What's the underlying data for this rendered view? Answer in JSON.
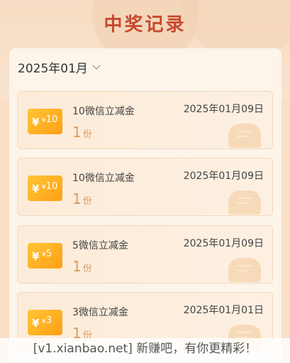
{
  "header": {
    "title": "中奖记录"
  },
  "filter": {
    "month": "2025年01月"
  },
  "records": [
    {
      "coupon_value": "10",
      "coupon_symbol": "¥",
      "title": "10微信立减金",
      "date": "2025年01月09日",
      "qty": "1",
      "unit": "份"
    },
    {
      "coupon_value": "10",
      "coupon_symbol": "¥",
      "title": "10微信立减金",
      "date": "2025年01月09日",
      "qty": "1",
      "unit": "份"
    },
    {
      "coupon_value": "5",
      "coupon_symbol": "¥",
      "title": "5微信立减金",
      "date": "2025年01月09日",
      "qty": "1",
      "unit": "份"
    },
    {
      "coupon_value": "3",
      "coupon_symbol": "¥",
      "title": "3微信立减金",
      "date": "2025年01月01日",
      "qty": "1",
      "unit": "份"
    }
  ],
  "watermark": "[v1.xianbao.net] 新赚吧，有你更精彩！",
  "colors": {
    "accent": "#c64a2e",
    "coupon": "#ffb325",
    "background": "#f8dfc7"
  }
}
